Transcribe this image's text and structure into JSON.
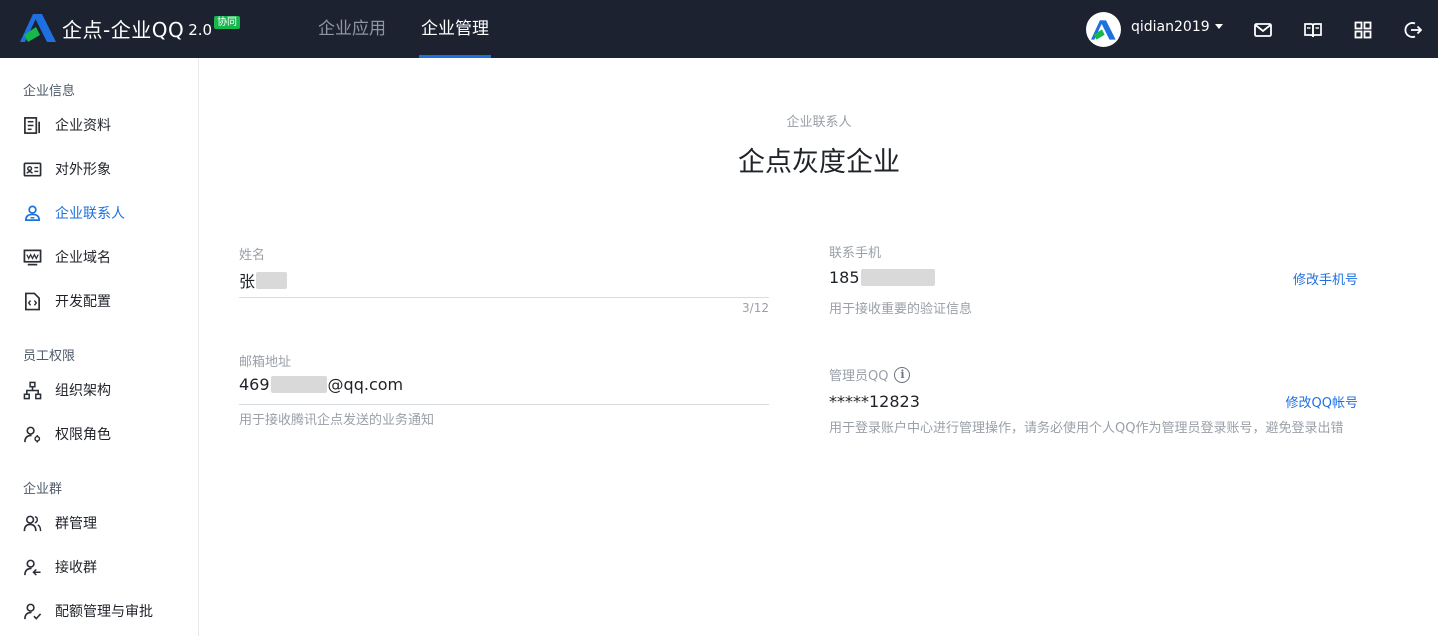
{
  "app": {
    "name": "企点-企业QQ",
    "version": "2.0",
    "badge": "协同",
    "accent_color": "#1e70e0",
    "topbar_color": "#1d2230"
  },
  "nav": {
    "tabs": [
      {
        "label": "企业应用",
        "active": false
      },
      {
        "label": "企业管理",
        "active": true
      }
    ]
  },
  "user": {
    "name": "qidian2019",
    "icons": [
      "mail-icon",
      "book-icon",
      "grid-apps-icon",
      "logout-icon"
    ]
  },
  "sidebar": {
    "groups": [
      {
        "title": "企业信息",
        "items": [
          {
            "label": "企业资料",
            "icon": "document-icon",
            "active": false
          },
          {
            "label": "对外形象",
            "icon": "id-card-icon",
            "active": false
          },
          {
            "label": "企业联系人",
            "icon": "contact-person-icon",
            "active": true
          },
          {
            "label": "企业域名",
            "icon": "monitor-icon",
            "active": false
          },
          {
            "label": "开发配置",
            "icon": "code-file-icon",
            "active": false
          }
        ]
      },
      {
        "title": "员工权限",
        "items": [
          {
            "label": "组织架构",
            "icon": "org-chart-icon",
            "active": false
          },
          {
            "label": "权限角色",
            "icon": "user-gear-icon",
            "active": false
          }
        ]
      },
      {
        "title": "企业群",
        "items": [
          {
            "label": "群管理",
            "icon": "users-icon",
            "active": false
          },
          {
            "label": "接收群",
            "icon": "user-receive-icon",
            "active": false
          },
          {
            "label": "配额管理与审批",
            "icon": "user-check-icon",
            "active": false
          }
        ]
      }
    ]
  },
  "main": {
    "subtitle": "企业联系人",
    "title": "企点灰度企业",
    "name_field": {
      "label": "姓名",
      "value": "张",
      "counter": "3/12"
    },
    "email_field": {
      "label": "邮箱地址",
      "value_prefix": "469",
      "value_suffix": "@qq.com",
      "hint": "用于接收腾讯企点发送的业务通知"
    },
    "phone_field": {
      "label": "联系手机",
      "value": "185",
      "hint": "用于接收重要的验证信息",
      "action": "修改手机号"
    },
    "admin_qq_field": {
      "label": "管理员QQ",
      "value": "*****12823",
      "hint": "用于登录账户中心进行管理操作，请务必使用个人QQ作为管理员登录账号，避免登录出错",
      "action": "修改QQ帐号"
    }
  }
}
